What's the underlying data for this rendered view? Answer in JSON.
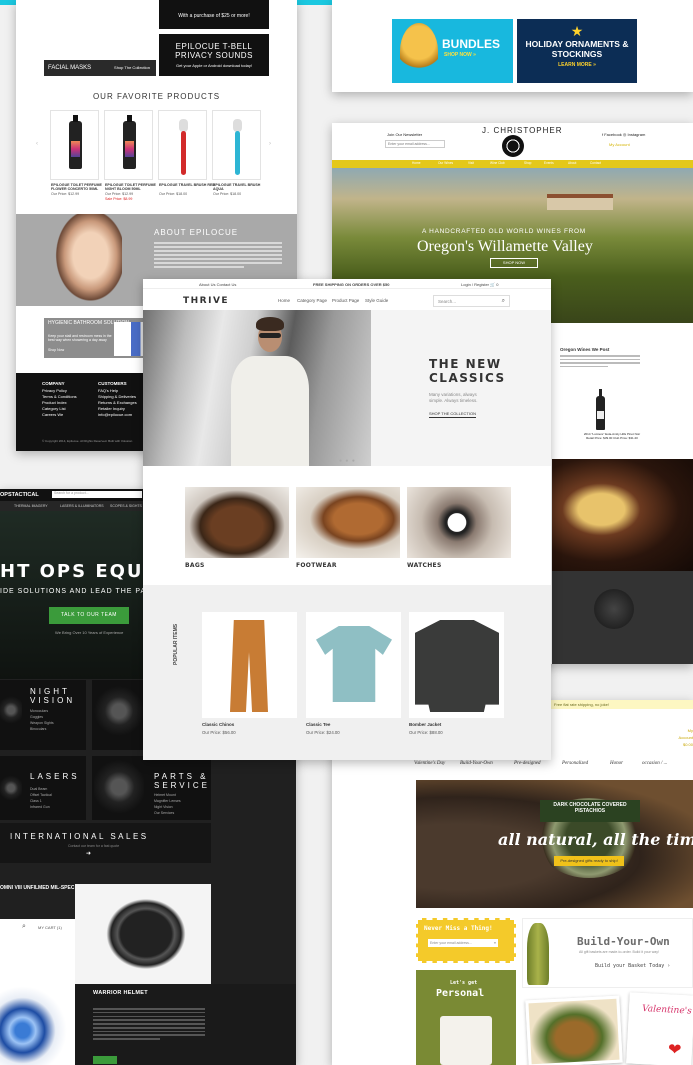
{
  "colors": {
    "accent_cyan": "#1bc8e0",
    "jc_gold": "#e4c81a",
    "tac_green": "#3b9b3b",
    "nuts_yellow": "#f4ca2a"
  },
  "epilocue": {
    "facial_label": "FACIAL MASKS",
    "facial_link": "Shop The Collection",
    "promo_top": "With a purchase of $25 or more!",
    "app_title": "EPILOCUE T-BELL PRIVACY SOUNDS",
    "app_sub": "Get your Apple or Android download today!",
    "fav_title": "OUR FAVORITE PRODUCTS",
    "products": [
      {
        "name": "EPILOGUE TOILET PERFUME FLOWER CONCERTO 50ML",
        "price": "Our Price: $12.99",
        "sale": ""
      },
      {
        "name": "EPILOGUE TOILET PERFUME NIGHT BLOOM 50ML",
        "price": "Our Price: $12.99",
        "sale": "Sale Price: $8.99"
      },
      {
        "name": "EPILOGUE TRAVEL BRUSH RED",
        "price": "Our Price: $18.00",
        "sale": ""
      },
      {
        "name": "EPILOGUE TRAVEL BRUSH AQUA",
        "price": "Our Price: $18.00",
        "sale": ""
      }
    ],
    "about_title": "ABOUT EPILOCUE",
    "hyg_title": "HYGIENIC BATHROOM SOLUTION",
    "hyg_sub": "Keep your stall and restroom mess in the best way when showering a day away",
    "hyg_shop": "Shop Now",
    "footer_company_title": "COMPANY",
    "footer_company": [
      "Privacy Policy",
      "Terms & Conditions",
      "Product Index",
      "Category List",
      "Careers We"
    ],
    "footer_customers_title": "CUSTOMERS",
    "footer_customers": [
      "FAQ's Help",
      "Shipping & Deliveries",
      "Returns & Exchanges",
      "Retailer Inquiry",
      "info@epilocue.com"
    ],
    "copyright": "© Copyright 2014, Epilocue. All Rights Reserved. Built with Volusion"
  },
  "bundles": {
    "b1_title": "BUNDLES",
    "b1_cta": "SHOP NOW »",
    "b2_star": "★",
    "b2_title": "HOLIDAY ORNAMENTS & STOCKINGS",
    "b2_cta": "LEARN MORE »"
  },
  "jchristopher": {
    "logo": "J. CHRISTOPHER",
    "join": "Join Our Newsletter",
    "email_placeholder": "Enter your email address...",
    "social": "f Facebook   ◎ Instagram",
    "myacc": "My Account",
    "nav": [
      "Home",
      "Our Wines",
      "Visit",
      "Wine Club",
      "Shop",
      "Events",
      "About",
      "Contact"
    ],
    "hero_sub": "A HANDCRAFTED OLD WORLD WINES FROM",
    "hero_title": "Oregon's Willamette Valley",
    "hero_cta": "SHOP NOW",
    "wine_head": "Oregon Wines We Post",
    "wine_caption": "2014 \"Lumiere\" Eola-Amity Hills Pinot Noir  Retail Price: $39.00  Club Price: $31.20"
  },
  "thrive": {
    "strip_left": "About Us   Contact Us",
    "strip_center": "FREE SHIPPING ON ORDERS OVER $50",
    "strip_right": "Login / Register   🛒 0",
    "brand": "THRIVE",
    "nav": [
      "Home",
      "Category Page",
      "Product Page",
      "Style Guide"
    ],
    "search_placeholder": "Search...",
    "search_icon": "⌕",
    "hero_title": "THE NEW CLASSICS",
    "hero_tag": "Many variations, always simple. Always timeless.",
    "hero_cta": "SHOP THE COLLECTION",
    "dots": "● ● ●",
    "categories": [
      "BAGS",
      "FOOTWEAR",
      "WATCHES"
    ],
    "popular_label": "POPULAR ITEMS",
    "products": [
      {
        "name": "Classic Chinos",
        "price": "Our Price: $56.00"
      },
      {
        "name": "Classic Tee",
        "price": "Our Price: $24.00"
      },
      {
        "name": "Bomber Jacket",
        "price": "Our Price: $88.00"
      }
    ]
  },
  "tactical": {
    "brand": "OPSTACTICAL",
    "search_placeholder": "Search for a product...",
    "nav": [
      "THERMAL IMAGERY",
      "LASERS & ILLUMINATORS",
      "SCOPES & SIGHTS"
    ],
    "hero_title": "HT OPS EQUIPMENT",
    "hero_sub": "IDE SOLUTIONS AND LEAD THE PATH FOR C",
    "hero_cta": "TALK TO OUR TEAM",
    "hero_exp": "We Bring Over 10 Years of Experience",
    "nv_title": "NIGHT VISION",
    "nv_items": [
      "Monoculars",
      "Goggles",
      "Weapon Sights",
      "Binoculars"
    ],
    "las_title": "LASERS",
    "las_items": [
      "Dual Beam",
      "Offset Tactical",
      "Class 1",
      "Infrared Gun"
    ],
    "parts_title": "PARTS & SERVICE",
    "parts_items": [
      "Helmet Mount",
      "Magnifier Lenses",
      "Night Vision",
      "Our Services"
    ],
    "intl_title": "INTERNATIONAL SALES",
    "intl_sub": "Contact our team for a fast quote",
    "intl_arrow": "➜",
    "omni": "OMNI VIII UNFILMED MIL-SPEC",
    "cart_icon": "⌕",
    "cart_label": "MY CART (1)",
    "helmet_title": "WARRIOR HELMET"
  },
  "nuts": {
    "ship": "Free flat rate shipping, no joke!",
    "account": "My Account",
    "cart_total": "$0.00",
    "nav": [
      "Valentine's Day",
      "Build-Your-Own",
      "Pre-designed",
      "Personalized",
      "Honor",
      "occasion / ..."
    ],
    "tin_label": "DARK CHOCOLATE COVERED PISTACHIOS",
    "hero_title": "all natural, all the time",
    "hero_cta": "Pre-designed gifts ready to ship!",
    "never_miss": "Never Miss a Thing!",
    "email_placeholder": "Enter your email address...",
    "email_go": "»",
    "byo_title": "Build-Your-Own",
    "byo_sub": "All gift baskets are made-to-order. Build it your way!",
    "byo_cta": "Build your Basket Today ›",
    "pers_l1": "Let's get",
    "pers_l2": "Personal",
    "val_title": "Valentine's basket",
    "heart": "❤"
  }
}
